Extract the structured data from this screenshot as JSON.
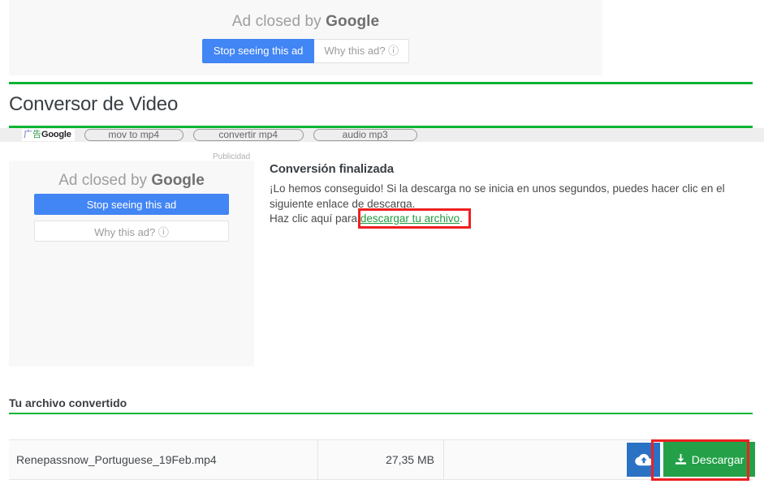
{
  "top_ad": {
    "closed_prefix": "Ad closed by ",
    "brand": "Google",
    "stop_label": "Stop seeing this ad",
    "why_label": "Why this ad? ⓘ"
  },
  "header": {
    "title": "Conversor de Video"
  },
  "ad_strip": {
    "badge_cn1": "广",
    "badge_cn2": "告",
    "badge_brand": "Google",
    "keywords": [
      {
        "label": "mov to mp4"
      },
      {
        "label": "convertir mp4"
      },
      {
        "label": "audio mp3"
      }
    ]
  },
  "sidebar_ad": {
    "publicidad_label": "Publicidad",
    "closed_prefix": "Ad closed by ",
    "brand": "Google",
    "stop_label": "Stop seeing this ad",
    "why_label": "Why this ad? ⓘ"
  },
  "main": {
    "heading": "Conversión finalizada",
    "body": "¡Lo hemos conseguido! Si la descarga no se inicia en unos segundos, puedes hacer clic en el siguiente enlace de descarga.",
    "line3_prefix": "Haz clic aquí para ",
    "link_label": "descargar tu archivo",
    "line3_suffix": "."
  },
  "section": {
    "title": "Tu archivo convertido"
  },
  "file_row": {
    "name": "Renepassnow_Portuguese_19Feb.mp4",
    "size": "27,35 MB",
    "cloud_icon": "cloud-upload-icon",
    "download_label": "Descargar",
    "download_icon": "download-icon"
  },
  "colors": {
    "green_rule": "#0bb432",
    "link_green": "#1f9d3f",
    "highlight_red": "#ef2020",
    "download_green": "#24a148",
    "cloud_blue": "#2a72c4",
    "ad_blue": "#4285f4"
  }
}
